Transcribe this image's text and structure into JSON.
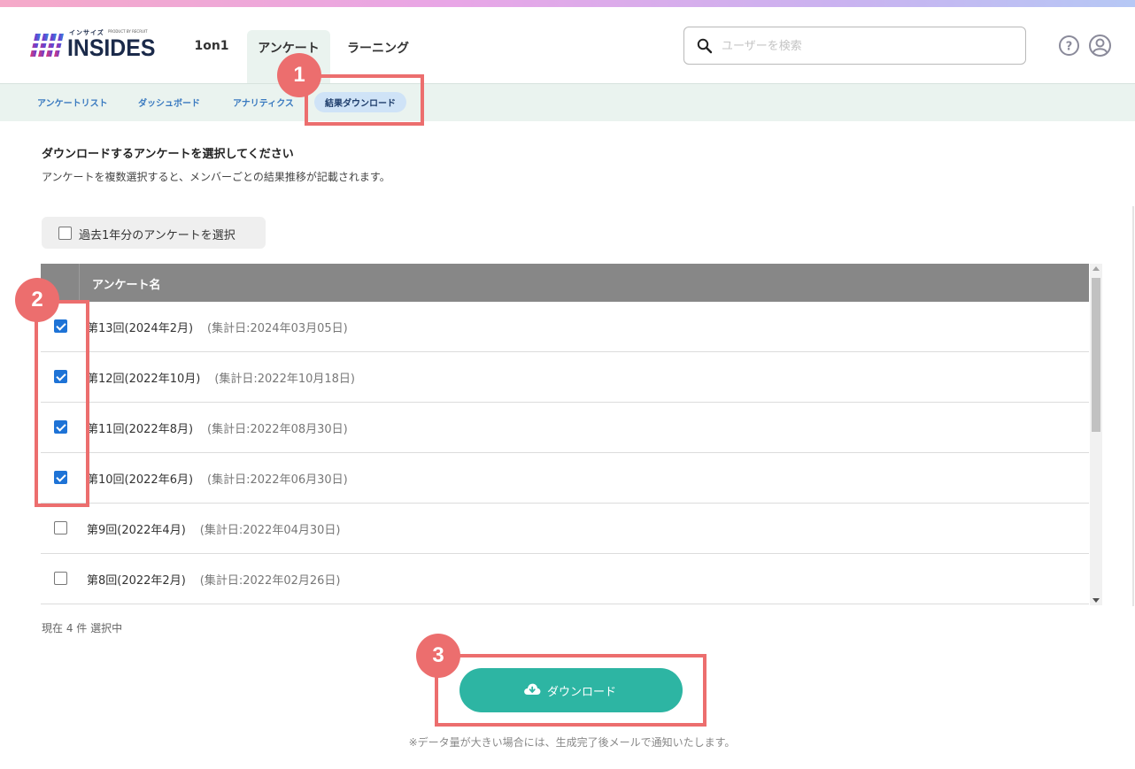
{
  "brand": {
    "logo_text": "INSIDES",
    "logo_kana": "インサイズ",
    "logo_tagline": "PRODUCT BY RECRUIT"
  },
  "nav": {
    "tabs": [
      {
        "label": "1on1"
      },
      {
        "label": "アンケート",
        "active": true
      },
      {
        "label": "ラーニング"
      }
    ]
  },
  "search": {
    "placeholder": "ユーザーを検索",
    "value": ""
  },
  "subnav": {
    "tabs": [
      {
        "label": "アンケートリスト"
      },
      {
        "label": "ダッシュボード"
      },
      {
        "label": "アナリティクス"
      },
      {
        "label": "結果ダウンロード",
        "active": true
      }
    ]
  },
  "content": {
    "heading": "ダウンロードするアンケートを選択してください",
    "description": "アンケートを複数選択すると、メンバーごとの結果推移が記載されます。",
    "select_year_label": "過去1年分のアンケートを選択",
    "table_header": "アンケート名",
    "rows": [
      {
        "name": "第13回(2024年2月)",
        "date": "(集計日:2024年03月05日)",
        "checked": true
      },
      {
        "name": "第12回(2022年10月)",
        "date": "(集計日:2022年10月18日)",
        "checked": true
      },
      {
        "name": "第11回(2022年8月)",
        "date": "(集計日:2022年08月30日)",
        "checked": true
      },
      {
        "name": "第10回(2022年6月)",
        "date": "(集計日:2022年06月30日)",
        "checked": true
      },
      {
        "name": "第9回(2022年4月)",
        "date": "(集計日:2022年04月30日)",
        "checked": false
      },
      {
        "name": "第8回(2022年2月)",
        "date": "(集計日:2022年02月26日)",
        "checked": false
      }
    ],
    "selection_count": "現在 4 件 選択中",
    "download_label": "ダウンロード",
    "note": "※データ量が大きい場合には、生成完了後メールで通知いたします。"
  },
  "annotations": {
    "badge1": "1",
    "badge2": "2",
    "badge3": "3"
  },
  "colors": {
    "accent": "#2db5a3",
    "highlight": "#ec6e6e",
    "checkbox": "#1e73d6",
    "subnav_bg": "#eaf3ef"
  }
}
